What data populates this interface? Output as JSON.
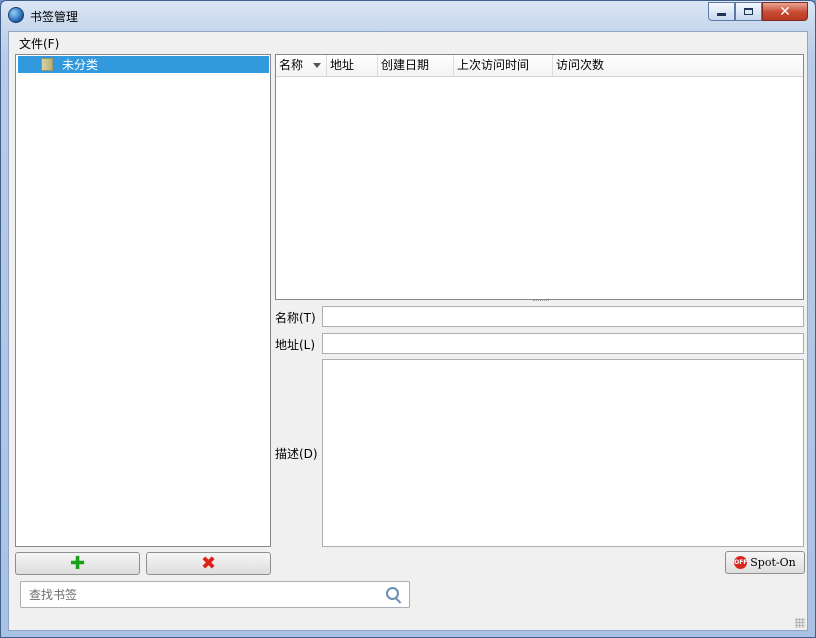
{
  "window": {
    "title": "书签管理"
  },
  "menu": {
    "file": "文件(F)"
  },
  "tree": {
    "items": [
      {
        "label": "未分类"
      }
    ]
  },
  "list": {
    "columns": [
      {
        "label": "名称"
      },
      {
        "label": "地址"
      },
      {
        "label": "创建日期"
      },
      {
        "label": "上次访问时间"
      },
      {
        "label": "访问次数"
      }
    ]
  },
  "form": {
    "name_label": "名称(T)",
    "url_label": "地址(L)",
    "desc_label": "描述(D)",
    "name_value": "",
    "url_value": "",
    "desc_value": ""
  },
  "buttons": {
    "spot_on": "Spot-On",
    "spot_icon": "OFF"
  },
  "search": {
    "placeholder": "查找书签",
    "value": ""
  },
  "icons": {
    "app": "app-globe-icon",
    "folder": "folder-icon",
    "add": "plus-icon",
    "delete": "delete-x-icon",
    "search": "search-icon"
  }
}
